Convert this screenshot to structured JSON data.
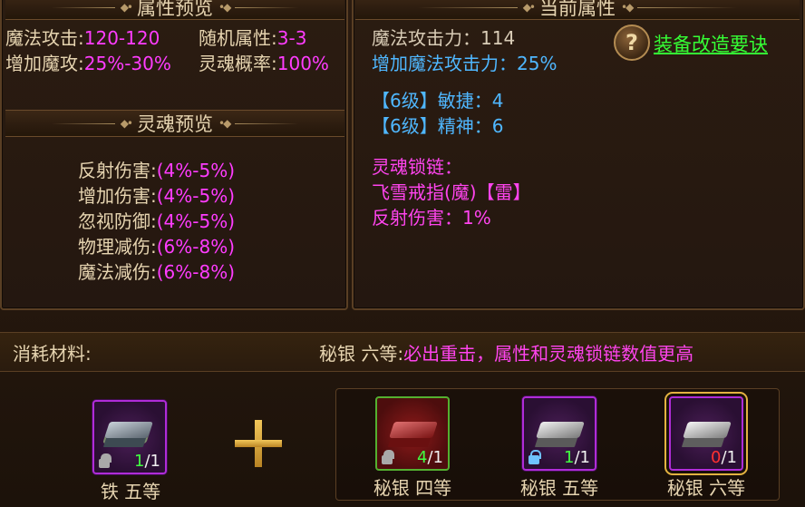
{
  "left_panel": {
    "header_title": "属性预览",
    "stats": [
      {
        "label": "魔法攻击:",
        "value": "120-120"
      },
      {
        "label": "随机属性:",
        "value": "3-3"
      },
      {
        "label": "增加魔攻:",
        "value": "25%-30%"
      },
      {
        "label": "灵魂概率:",
        "value": "100%"
      }
    ],
    "soul_header": "灵魂预览",
    "soul_stats": [
      {
        "label": "反射伤害:",
        "value": "(4%-5%)"
      },
      {
        "label": "增加伤害:",
        "value": "(4%-5%)"
      },
      {
        "label": "忽视防御:",
        "value": "(4%-5%)"
      },
      {
        "label": "物理减伤:",
        "value": "(6%-8%)"
      },
      {
        "label": "魔法减伤:",
        "value": "(6%-8%)"
      }
    ]
  },
  "right_panel": {
    "header_title": "当前属性",
    "magic_attack": "魔法攻击力：114",
    "magic_attack_bonus": "增加魔法攻击力：25%",
    "attr_agility": "【6级】敏捷：4",
    "attr_spirit": "【6级】精神：6",
    "soul_chain_title": "灵魂锁链：",
    "soul_chain_item": "飞雪戒指(魔)【雷】",
    "soul_chain_effect": "反射伤害：1%",
    "help_icon": "?",
    "help_link": "装备改造要诀"
  },
  "materials": {
    "label": "消耗材料:",
    "hint_item": "秘银 六等:",
    "hint_text": "必出重击，属性和灵魂锁链数值更高",
    "base_item": {
      "name": "铁 五等",
      "have": "1",
      "need": "/1"
    },
    "plus_icon": "plus-icon",
    "options": [
      {
        "name": "秘银 四等",
        "have": "4",
        "need": "/1"
      },
      {
        "name": "秘银 五等",
        "have": "1",
        "need": "/1"
      },
      {
        "name": "秘银 六等",
        "have": "0",
        "need": "/1"
      }
    ]
  },
  "colors": {
    "pink": "#ff3cff",
    "blue": "#4fb7ff",
    "green_link": "#35ff35",
    "gold": "#e3b241"
  }
}
